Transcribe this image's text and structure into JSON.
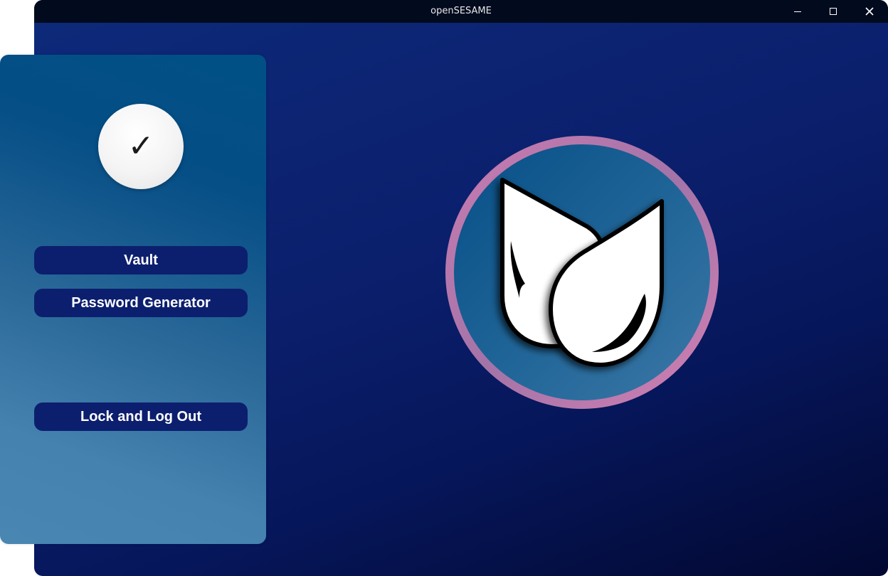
{
  "window": {
    "title": "openSESAME",
    "controls": {
      "minimize": "minimize-icon",
      "maximize": "maximize-icon",
      "close": "close-icon"
    }
  },
  "sidebar": {
    "status_icon": "✓",
    "nav": [
      {
        "label": "Vault"
      },
      {
        "label": "Password Generator"
      },
      {
        "label": "Lock and Log Out"
      }
    ]
  },
  "main": {
    "logo": "opensesame-logo"
  },
  "colors": {
    "titlebar": "#020a1e",
    "button": "#0c1f6e",
    "logo_ring": "#c97bb0",
    "logo_fill": "#1b5e96"
  }
}
